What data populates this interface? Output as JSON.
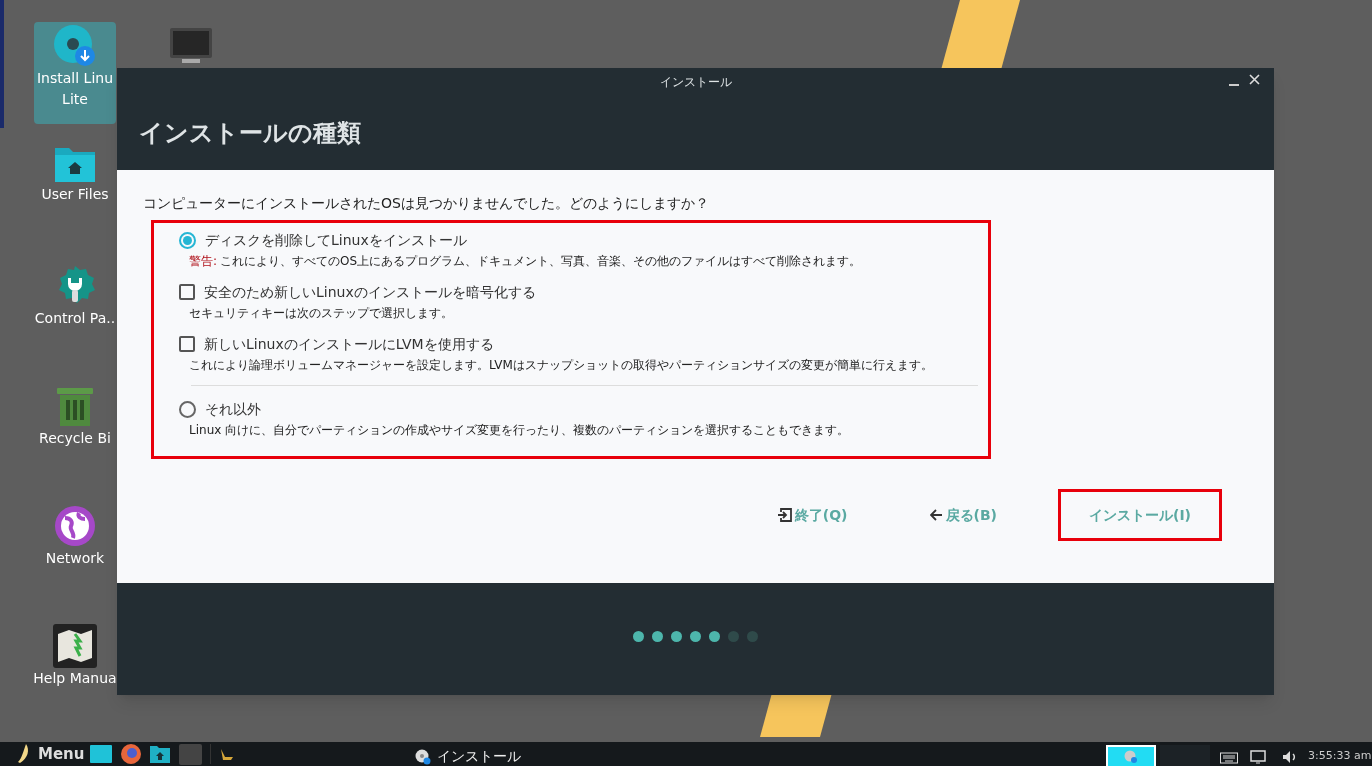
{
  "desktop_icons": [
    {
      "lines": [
        "Install Linu",
        "Lite"
      ],
      "selected": true,
      "kind": "installer"
    },
    {
      "lines": [
        "User Files"
      ],
      "selected": false,
      "kind": "folder"
    },
    {
      "lines": [
        "Control Pa.."
      ],
      "selected": false,
      "kind": "gear"
    },
    {
      "lines": [
        "Recycle Bi"
      ],
      "selected": false,
      "kind": "trash"
    },
    {
      "lines": [
        "Network"
      ],
      "selected": false,
      "kind": "globe"
    },
    {
      "lines": [
        "Help Manua"
      ],
      "selected": false,
      "kind": "map"
    }
  ],
  "window": {
    "title": "インストール",
    "heading": "インストールの種類",
    "question": "コンピューターにインストールされたOSは見つかりませんでした。どのようにしますか？",
    "options": [
      {
        "kind": "radio",
        "selected": true,
        "label": "ディスクを削除してLinuxをインストール",
        "warning_label": "警告:",
        "description": "これにより、すべてのOS上にあるプログラム、ドキュメント、写真、音楽、その他のファイルはすべて削除されます。"
      },
      {
        "kind": "checkbox",
        "checked": false,
        "label": "安全のため新しいLinuxのインストールを暗号化する",
        "description": "セキュリティキーは次のステップで選択します。"
      },
      {
        "kind": "checkbox",
        "checked": false,
        "label": "新しいLinuxのインストールにLVMを使用する",
        "description": "これにより論理ボリュームマネージャーを設定します。LVMはスナップショットの取得やパーティションサイズの変更が簡単に行えます。"
      },
      {
        "kind": "separator"
      },
      {
        "kind": "radio",
        "selected": false,
        "label": "それ以外",
        "description": "Linux 向けに、自分でパーティションの作成やサイズ変更を行ったり、複数のパーティションを選択することもできます。"
      }
    ],
    "buttons": [
      {
        "kind": "quit",
        "label": "終了(Q)",
        "highlighted": false
      },
      {
        "kind": "back",
        "label": "戻る(B)",
        "highlighted": false
      },
      {
        "kind": "install",
        "label": "インストール(I)",
        "highlighted": true
      }
    ],
    "steps": [
      {
        "done": true
      },
      {
        "done": true
      },
      {
        "done": true
      },
      {
        "done": true
      },
      {
        "done": true
      },
      {
        "done": false
      },
      {
        "done": false
      }
    ]
  },
  "taskbar": {
    "menu": "Menu",
    "task": "インストール",
    "clock": "3:55:33 am"
  }
}
